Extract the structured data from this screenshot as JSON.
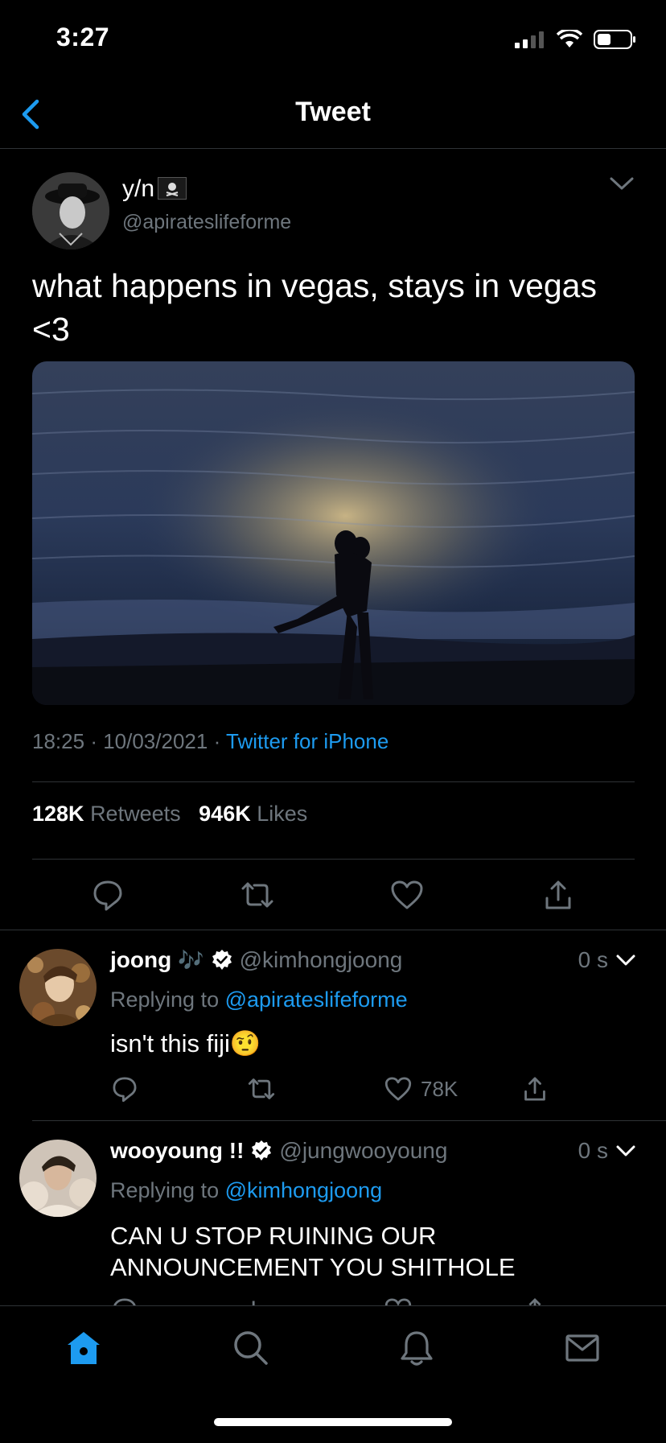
{
  "status_bar": {
    "time": "3:27"
  },
  "header": {
    "title": "Tweet"
  },
  "tweet": {
    "author_name": "y/n",
    "author_handle": "@apirateslifeforme",
    "text_line1": "what happens in vegas, stays in vegas",
    "text_line2": "<3",
    "time": "18:25",
    "date": "10/03/2021",
    "source": "Twitter for iPhone",
    "retweets_count": "128K",
    "retweets_label": "Retweets",
    "likes_count": "946K",
    "likes_label": "Likes"
  },
  "replies": [
    {
      "name": "joong",
      "emoji": "🎶",
      "handle": "@kimhongjoong",
      "time": "0 s",
      "replying_prefix": "Replying to",
      "replying_to": "@apirateslifeforme",
      "text": "isn't this fiji",
      "text_emoji": "🤨",
      "likes": "78K"
    },
    {
      "name": "wooyoung !!",
      "handle": "@jungwooyoung",
      "time": "0 s",
      "replying_prefix": "Replying to",
      "replying_to": "@kimhongjoong",
      "text_line1": "CAN U STOP RUINING OUR",
      "text_line2": "ANNOUNCEMENT YOU SHITHOLE"
    }
  ],
  "colors": {
    "accent": "#1d9bf0",
    "muted": "#6e767d",
    "divider": "#2f3336"
  },
  "icons": [
    "back-chevron-icon",
    "reply-icon",
    "retweet-icon",
    "like-icon",
    "share-icon",
    "verified-icon",
    "home-icon",
    "search-icon",
    "bell-icon",
    "mail-icon"
  ]
}
